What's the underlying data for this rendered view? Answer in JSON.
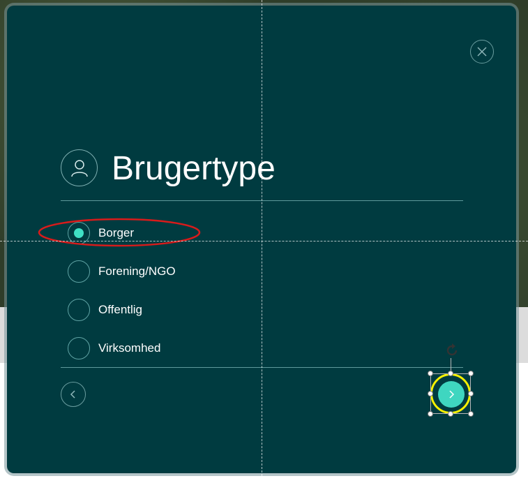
{
  "modal": {
    "title": "Brugertype",
    "options": [
      {
        "label": "Borger",
        "selected": true
      },
      {
        "label": "Forening/NGO",
        "selected": false
      },
      {
        "label": "Offentlig",
        "selected": false
      },
      {
        "label": "Virksomhed",
        "selected": false
      }
    ]
  },
  "icons": {
    "close": "close-icon",
    "header": "user-icon",
    "back": "chevron-left-icon",
    "next": "chevron-right-icon",
    "rotate": "rotate-icon"
  },
  "colors": {
    "modal_bg": "#003b40",
    "accent": "#3fd6c0",
    "annotation_ellipse": "#d81b1b",
    "selection_ring": "#f5f000"
  }
}
